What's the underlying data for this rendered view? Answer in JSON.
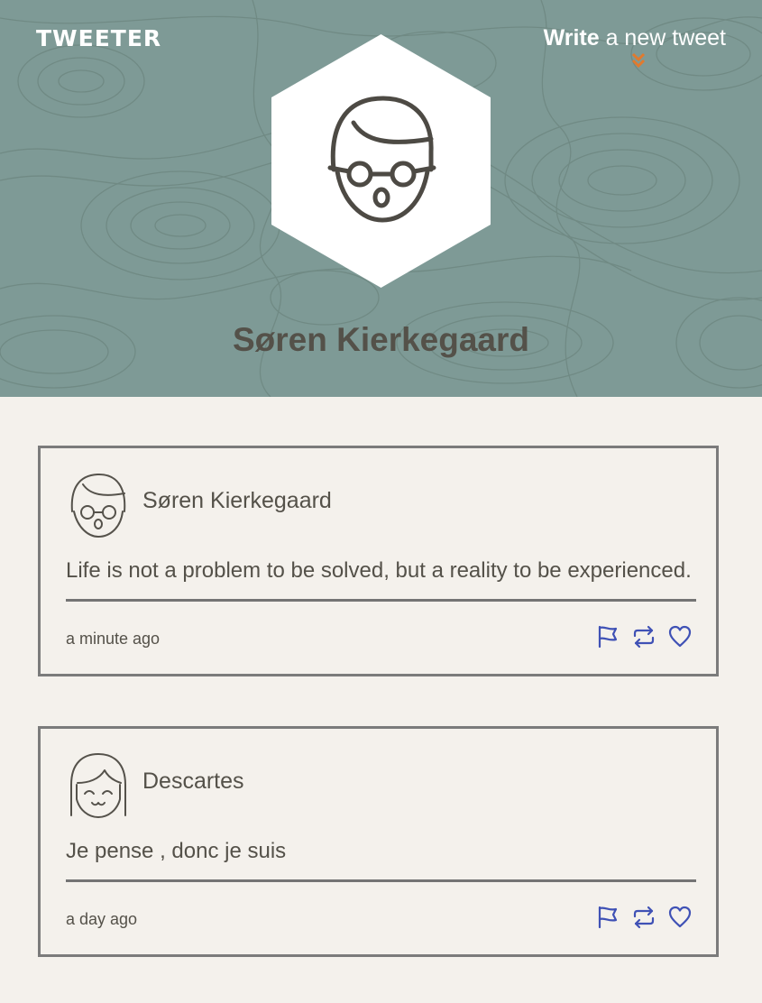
{
  "header": {
    "logo": "TWEETER",
    "write_bold": "Write",
    "write_rest": " a new tweet",
    "chevron_icon": "double-chevron-down-icon",
    "chevron_color": "#e07a2e"
  },
  "profile": {
    "name": "Søren Kierkegaard",
    "avatar_icon": "man-with-glasses-icon"
  },
  "tweets": [
    {
      "author": "Søren Kierkegaard",
      "avatar_icon": "man-with-glasses-icon",
      "content": "Life is not a problem to be solved, but a reality to be experienced.",
      "time": "a minute ago"
    },
    {
      "author": "Descartes",
      "avatar_icon": "smiling-girl-icon",
      "content": "Je pense , donc je suis",
      "time": "a day ago"
    }
  ],
  "actions": {
    "flag_icon": "flag-icon",
    "retweet_icon": "retweet-icon",
    "like_icon": "heart-icon",
    "icon_color": "#3f51b5"
  },
  "colors": {
    "hero_background": "#7e9a96",
    "page_background": "#f4f1ec",
    "text": "#545149",
    "border": "#7b7b7b"
  }
}
